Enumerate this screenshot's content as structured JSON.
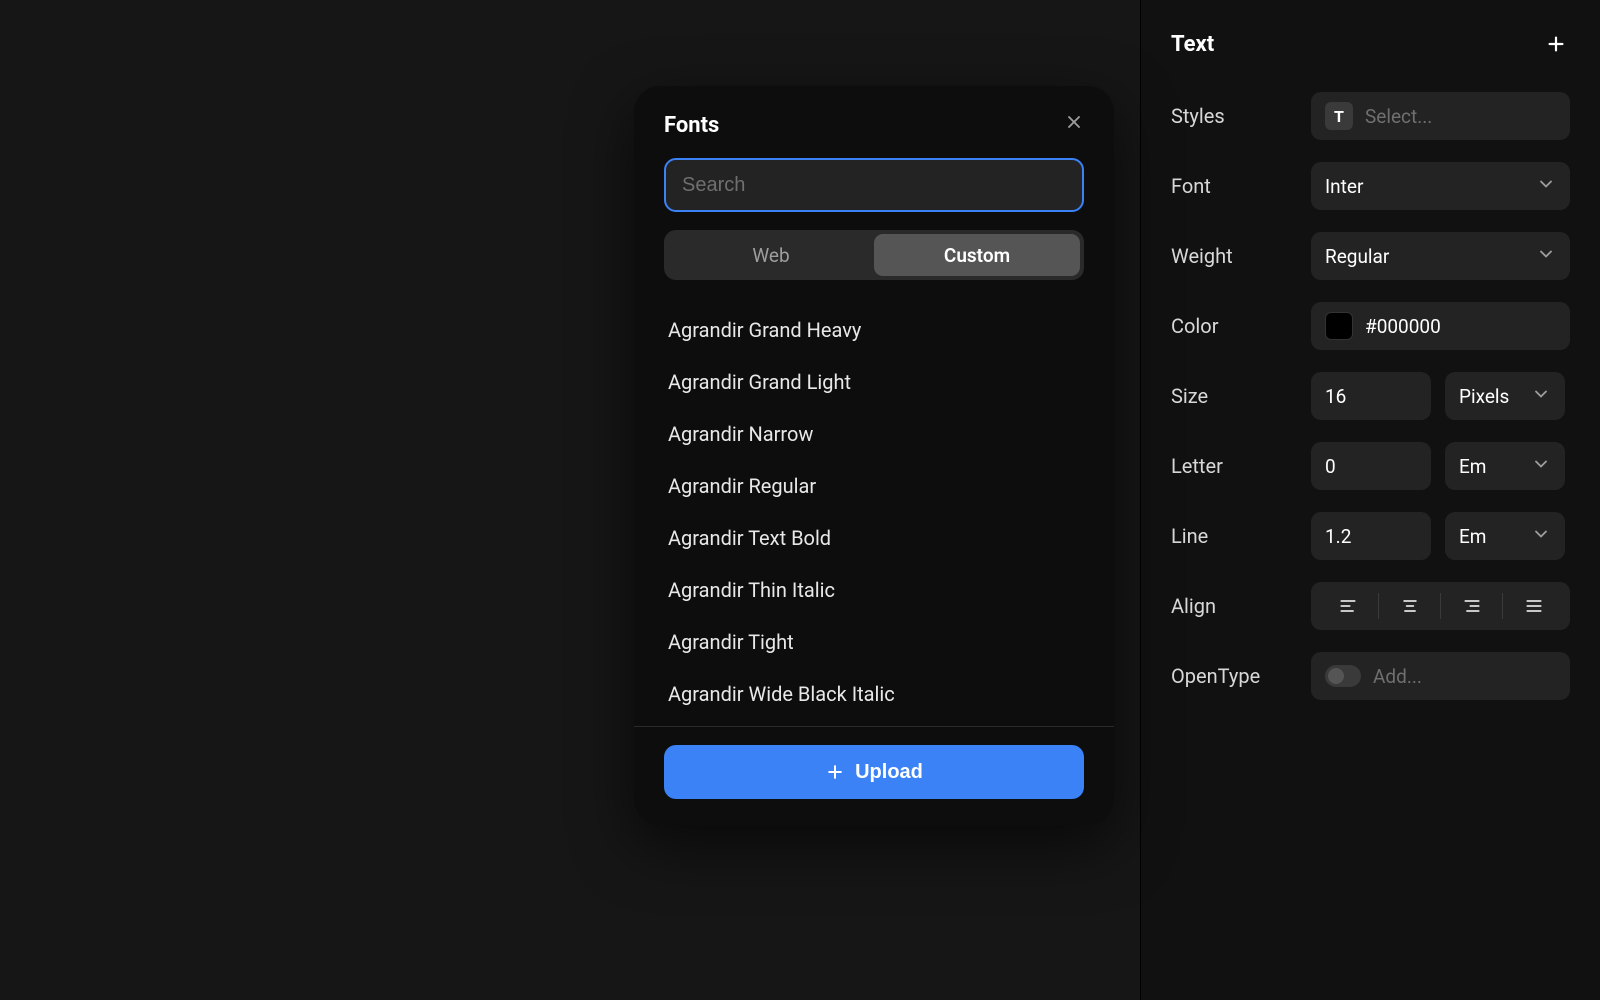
{
  "fonts_popover": {
    "title": "Fonts",
    "search_placeholder": "Search",
    "tabs": {
      "web": "Web",
      "custom": "Custom"
    },
    "active_tab": "custom",
    "list": [
      "Agrandir Grand Heavy",
      "Agrandir Grand Light",
      "Agrandir Narrow",
      "Agrandir Regular",
      "Agrandir Text Bold",
      "Agrandir Thin Italic",
      "Agrandir Tight",
      "Agrandir Wide Black Italic"
    ],
    "upload_label": "Upload"
  },
  "text_panel": {
    "title": "Text",
    "labels": {
      "styles": "Styles",
      "font": "Font",
      "weight": "Weight",
      "color": "Color",
      "size": "Size",
      "letter": "Letter",
      "line": "Line",
      "align": "Align",
      "opentype": "OpenType"
    },
    "values": {
      "styles_placeholder": "Select...",
      "font": "Inter",
      "weight": "Regular",
      "color_hex": "#000000",
      "size": "16",
      "size_unit": "Pixels",
      "letter": "0",
      "letter_unit": "Em",
      "line": "1.2",
      "line_unit": "Em",
      "opentype_placeholder": "Add..."
    }
  }
}
